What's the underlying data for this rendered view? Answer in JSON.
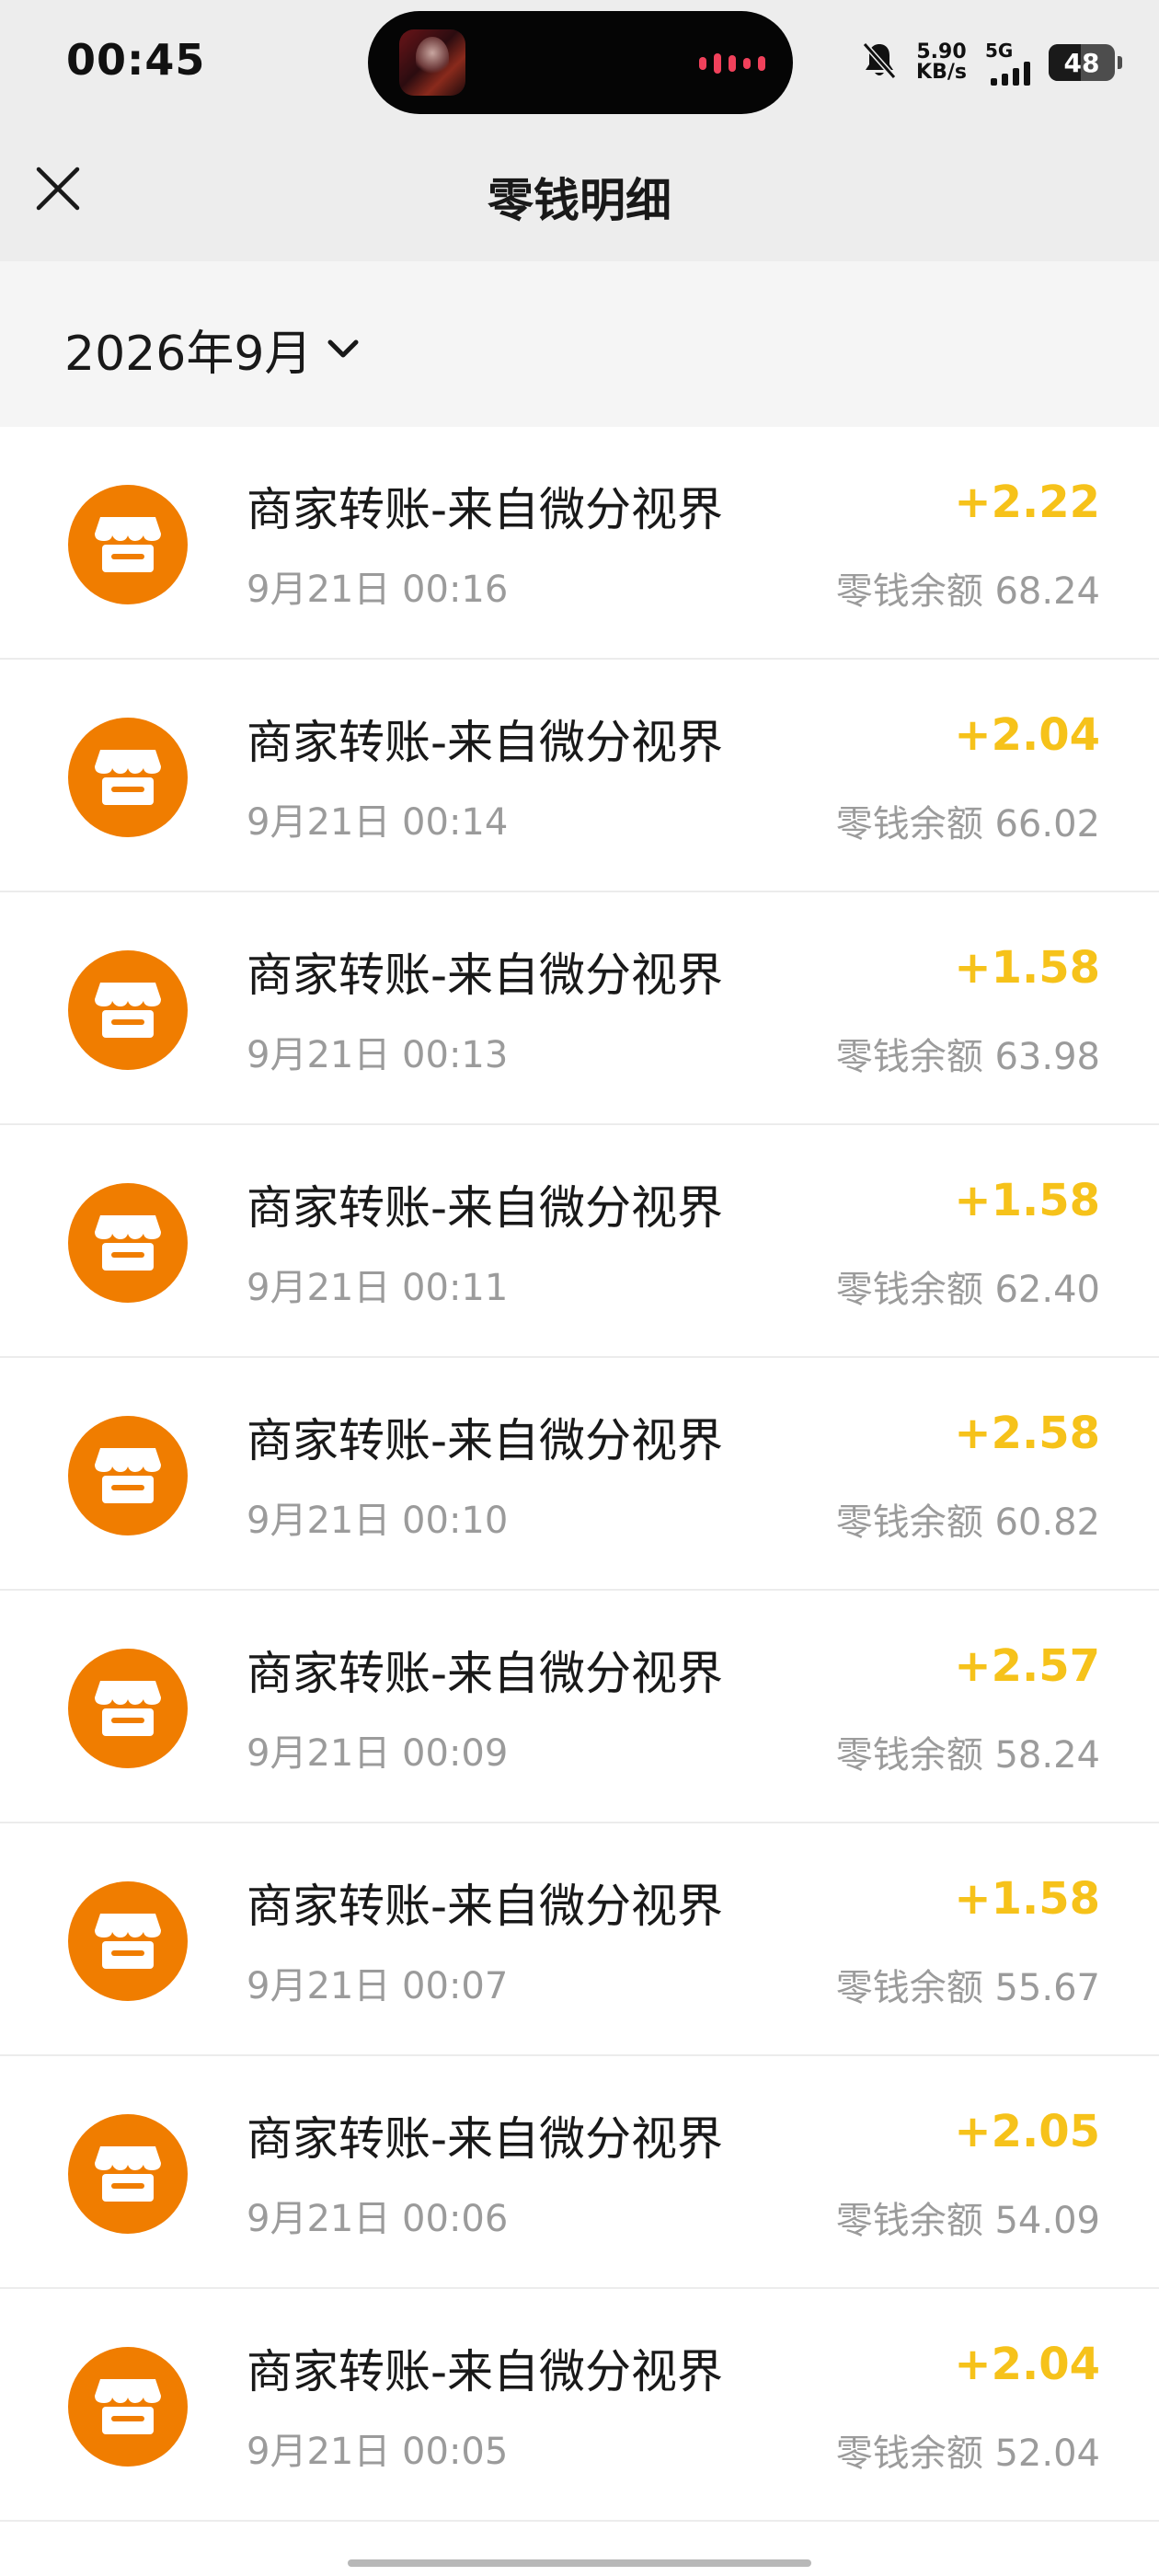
{
  "status_bar": {
    "time": "00:45",
    "net_speed_value": "5.90",
    "net_speed_unit": "KB/s",
    "network": "5G",
    "battery": "48",
    "icons": [
      "game-thumbnail-icon",
      "audio-wave-icon",
      "bell-muted-icon",
      "signal-bars-icon",
      "battery-icon"
    ]
  },
  "nav": {
    "title": "零钱明细",
    "close_icon": "close-icon"
  },
  "filter": {
    "month": "2026年9月",
    "icon": "chevron-down-icon"
  },
  "transactions": [
    {
      "title": "商家转账-来自微分视界",
      "time": "9月21日 00:16",
      "amount": "+2.22",
      "balance": "零钱余额 68.24"
    },
    {
      "title": "商家转账-来自微分视界",
      "time": "9月21日 00:14",
      "amount": "+2.04",
      "balance": "零钱余额 66.02"
    },
    {
      "title": "商家转账-来自微分视界",
      "time": "9月21日 00:13",
      "amount": "+1.58",
      "balance": "零钱余额 63.98"
    },
    {
      "title": "商家转账-来自微分视界",
      "time": "9月21日 00:11",
      "amount": "+1.58",
      "balance": "零钱余额 62.40"
    },
    {
      "title": "商家转账-来自微分视界",
      "time": "9月21日 00:10",
      "amount": "+2.58",
      "balance": "零钱余额 60.82"
    },
    {
      "title": "商家转账-来自微分视界",
      "time": "9月21日 00:09",
      "amount": "+2.57",
      "balance": "零钱余额 58.24"
    },
    {
      "title": "商家转账-来自微分视界",
      "time": "9月21日 00:07",
      "amount": "+1.58",
      "balance": "零钱余额 55.67"
    },
    {
      "title": "商家转账-来自微分视界",
      "time": "9月21日 00:06",
      "amount": "+2.05",
      "balance": "零钱余额 54.09"
    },
    {
      "title": "商家转账-来自微分视界",
      "time": "9月21日 00:05",
      "amount": "+2.04",
      "balance": "零钱余额 52.04"
    }
  ],
  "colors": {
    "accent_amount": "#f6c21a",
    "merchant_avatar": "#f07d00",
    "header_bg": "#ededed"
  }
}
